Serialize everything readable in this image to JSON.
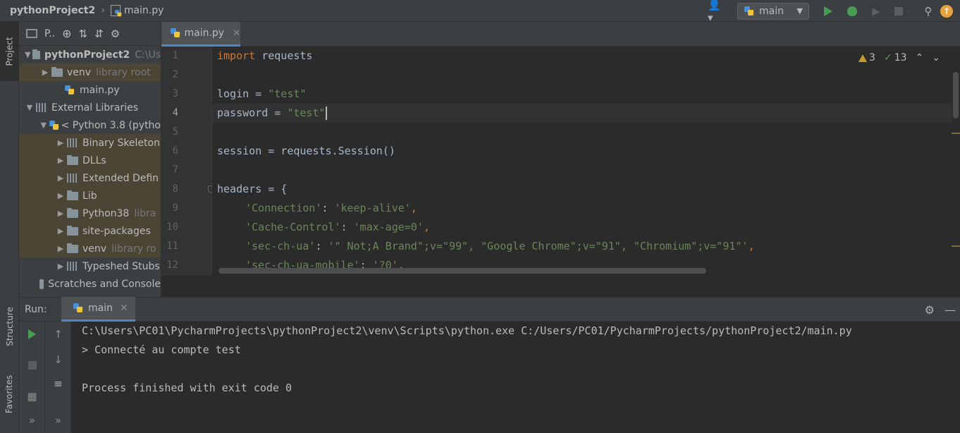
{
  "breadcrumb": {
    "project": "pythonProject2",
    "file": "main.py"
  },
  "run_config": {
    "selected": "main"
  },
  "left_strip": {
    "project_tab": "Project",
    "structure_tab": "Structure",
    "favorites_tab": "Favorites"
  },
  "project_panel": {
    "toolbar_label": "P..",
    "tree": [
      {
        "label": "pythonProject2",
        "extra": "C:\\Us",
        "bold": true
      },
      {
        "label": "venv",
        "extra": "library root"
      },
      {
        "label": "main.py",
        "extra": ""
      },
      {
        "label": "External Libraries",
        "extra": ""
      },
      {
        "label": "< Python 3.8 (pytho",
        "extra": ""
      },
      {
        "label": "Binary Skeleton",
        "extra": ""
      },
      {
        "label": "DLLs",
        "extra": ""
      },
      {
        "label": "Extended Defin",
        "extra": ""
      },
      {
        "label": "Lib",
        "extra": ""
      },
      {
        "label": "Python38",
        "extra": "libra"
      },
      {
        "label": "site-packages",
        "extra": ""
      },
      {
        "label": "venv",
        "extra": "library ro"
      },
      {
        "label": "Typeshed Stubs",
        "extra": ""
      },
      {
        "label": "Scratches and Console",
        "extra": ""
      }
    ]
  },
  "editor": {
    "tab_label": "main.py",
    "line_numbers": [
      "1",
      "2",
      "3",
      "4",
      "5",
      "6",
      "7",
      "8",
      "9",
      "10",
      "11",
      "12"
    ],
    "current_line": 4,
    "inspections": {
      "warnings": "3",
      "weak_warnings": "13"
    },
    "code": {
      "l1_kw": "import",
      "l1_rest": " requests",
      "l3_a": "login = ",
      "l3_s": "\"test\"",
      "l4_a": "password = ",
      "l4_s": "\"test\"",
      "l6": "session = requests.Session()",
      "l8": "headers = {",
      "l9_s1": "'Connection'",
      "l9_m": ": ",
      "l9_s2": "'keep-alive'",
      "l9_e": ",",
      "l10_s1": "'Cache-Control'",
      "l10_m": ": ",
      "l10_s2": "'max-age=0'",
      "l10_e": ",",
      "l11_s1": "'sec-ch-ua'",
      "l11_m": ": ",
      "l11_s2": "'\" Not;A Brand\";v=\"99\", \"Google Chrome\";v=\"91\", \"Chromium\";v=\"91\"'",
      "l11_e": ",",
      "l12_s1": "'sec-ch-ua-mobile'",
      "l12_m": ": ",
      "l12_s2": "'?0'",
      "l12_e": ","
    }
  },
  "run_panel": {
    "label": "Run:",
    "tab": "main",
    "console": [
      "C:\\Users\\PC01\\PycharmProjects\\pythonProject2\\venv\\Scripts\\python.exe C:/Users/PC01/PycharmProjects/pythonProject2/main.py",
      "> Connecté au compte test",
      "",
      "Process finished with exit code 0"
    ]
  },
  "colors": {
    "accent": "#4a88c7",
    "keyword": "#cc7832",
    "string": "#6a8759",
    "run_green": "#499c54"
  },
  "icons": [
    "user-icon",
    "python-icon",
    "run-icon",
    "debug-icon",
    "coverage-icon",
    "stop-icon",
    "search-icon",
    "update-icon",
    "gear-icon",
    "minimize-icon",
    "locate-icon",
    "expand-icon",
    "collapse-icon",
    "close-icon",
    "chevron-icon"
  ]
}
